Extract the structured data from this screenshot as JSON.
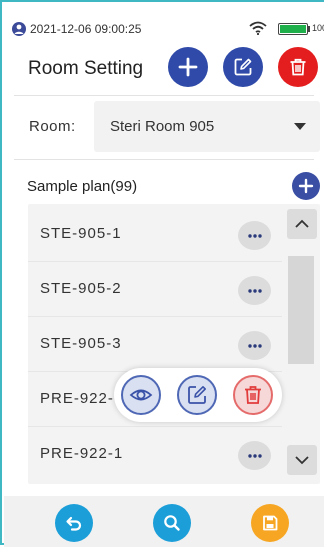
{
  "status_bar": {
    "datetime": "2021-12-06 09:00:25",
    "battery_text": "100%",
    "battery_level": 1.0,
    "battery_color": "#1fb04b"
  },
  "header": {
    "title": "Room Setting",
    "add_icon": "plus-icon",
    "edit_icon": "edit-icon",
    "delete_icon": "trash-icon"
  },
  "room": {
    "label": "Room:",
    "selected": "Steri Room 905"
  },
  "sample_plan": {
    "title": "Sample plan(99)",
    "items": [
      {
        "label": "STE-905-1"
      },
      {
        "label": "STE-905-2"
      },
      {
        "label": "STE-905-3"
      },
      {
        "label": "PRE-922-"
      },
      {
        "label": "PRE-922-1"
      }
    ]
  },
  "popup_actions": {
    "view_icon": "eye-icon",
    "edit_icon": "edit-icon",
    "delete_icon": "trash-icon"
  },
  "bottom_bar": {
    "back_icon": "back-arrow-icon",
    "search_icon": "search-icon",
    "save_icon": "save-icon"
  },
  "colors": {
    "primary": "#2f4aa8",
    "danger": "#e41e1e",
    "accent_blue": "#1c9fd9",
    "accent_orange": "#f6a623",
    "frame": "#3fb8c4"
  }
}
